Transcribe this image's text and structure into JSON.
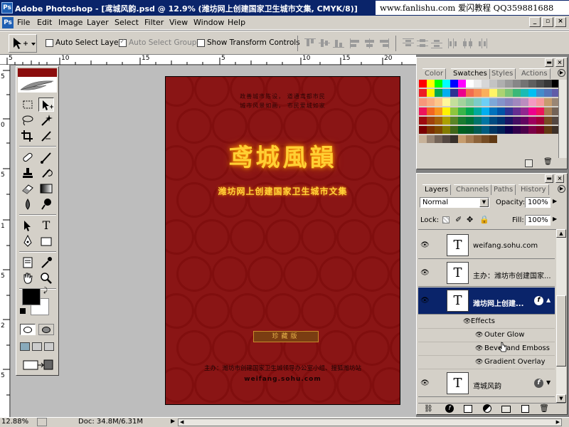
{
  "window": {
    "title": "Adobe Photoshop - [鸢城风韵.psd @ 12.9% (潍坊网上创建国家卫生城市文集, CMYK/8)]",
    "watermark": "www.fanlishu.com 爱闪教程 QQ359881688"
  },
  "menu": [
    "File",
    "Edit",
    "Image",
    "Layer",
    "Select",
    "Filter",
    "View",
    "Window",
    "Help"
  ],
  "options_bar": {
    "auto_select_layer": "Auto Select Layer",
    "auto_select_groups": "Auto Select Groups",
    "show_transform_controls": "Show Transform Controls"
  },
  "ruler": {
    "h": [
      "5",
      "10",
      "15",
      "5",
      "10",
      "15",
      "20"
    ],
    "v": [
      "5",
      "0",
      "5",
      "1",
      "5",
      "2",
      "5"
    ]
  },
  "document": {
    "header_line1": "政善城市陈设，  道通鸢都市民",
    "header_line2": "城市风景如画，  市民爱城如家",
    "title": "鸢城風韻",
    "subtitle": "潍坊网上创建国家卫生城市文集",
    "badge": "珍藏版",
    "footer": "主办：潍坊市创建国家卫生城领导办公室小组、搜狐潍坊站",
    "url": "weifang.sohu.com"
  },
  "swatches_panel": {
    "tabs": [
      "Color",
      "Swatches",
      "Styles",
      "Actions"
    ],
    "active_tab": "Swatches",
    "colors": [
      [
        "#ff0000",
        "#ffff00",
        "#00ff00",
        "#00ffff",
        "#0000ff",
        "#ff00ff",
        "#ffffff",
        "#ebebeb",
        "#d7d7d7",
        "#c3c3c3",
        "#afafaf",
        "#9b9b9b",
        "#878787",
        "#737373",
        "#5f5f5f",
        "#4b4b4b",
        "#373737",
        "#000000"
      ],
      [
        "#ed1c24",
        "#fff200",
        "#00a651",
        "#00aeef",
        "#2e3192",
        "#ec008c",
        "#f26c4f",
        "#f68e55",
        "#fbaf5c",
        "#fff467",
        "#acd372",
        "#7cc576",
        "#3bb878",
        "#1abbb4",
        "#00bff3",
        "#438ccb",
        "#5574b9",
        "#605ca8"
      ],
      [
        "#f7977a",
        "#f9ad81",
        "#fdc68a",
        "#fff79a",
        "#c4df9b",
        "#a3d39c",
        "#82ca9c",
        "#7accc8",
        "#6dcff6",
        "#7ea7d8",
        "#8493ca",
        "#8882be",
        "#a187be",
        "#bc8cbf",
        "#f49ac2",
        "#f6989d",
        "#c69c6d",
        "#998675"
      ],
      [
        "#ed145b",
        "#f26522",
        "#f7941d",
        "#fff200",
        "#8dc63f",
        "#39b54a",
        "#00a651",
        "#00a99d",
        "#00aeef",
        "#0072bc",
        "#0054a6",
        "#2e3192",
        "#662d91",
        "#92278f",
        "#ec008c",
        "#ed145b",
        "#a67c52",
        "#736357"
      ],
      [
        "#9e0b0f",
        "#a0410d",
        "#a36209",
        "#aba000",
        "#598527",
        "#1a7b30",
        "#007236",
        "#00746b",
        "#0076a3",
        "#004b80",
        "#003471",
        "#1b1464",
        "#440e62",
        "#630460",
        "#9e005d",
        "#9e0039",
        "#754c24",
        "#534741"
      ],
      [
        "#790000",
        "#7b2e00",
        "#7d4900",
        "#827b00",
        "#406618",
        "#005e20",
        "#005826",
        "#005952",
        "#005b7f",
        "#003663",
        "#002157",
        "#0d004c",
        "#32004b",
        "#4b0049",
        "#7b0046",
        "#7a0026",
        "#603913",
        "#3c3028"
      ],
      [
        "#c7b299",
        "#998675",
        "#736357",
        "#534741",
        "#37302a",
        "#c69c6d",
        "#a67c52",
        "#8c6239",
        "#754c24",
        "#603913"
      ]
    ]
  },
  "layers_panel": {
    "tabs": [
      "Layers",
      "Channels",
      "Paths",
      "History"
    ],
    "active_tab": "Layers",
    "blend_mode": "Normal",
    "opacity_label": "Opacity:",
    "opacity": "100%",
    "lock_label": "Lock:",
    "fill_label": "Fill:",
    "fill": "100%",
    "layers": [
      {
        "name": "weifang.sohu.com",
        "thumb": "T",
        "selected": false
      },
      {
        "name": "主办：潍坊市创建国家...",
        "thumb": "T",
        "selected": false
      },
      {
        "name": "潍坊网上创建...",
        "thumb": "T",
        "selected": true
      }
    ],
    "effects_label": "Effects",
    "effects": [
      "Outer Glow",
      "Bevel and Emboss",
      "Gradient Overlay"
    ],
    "bottom_layer": {
      "name": "鸢城风韵",
      "thumb": "T"
    }
  },
  "status": {
    "zoom": "12.88%",
    "doc": "Doc: 34.8M/6.31M"
  }
}
